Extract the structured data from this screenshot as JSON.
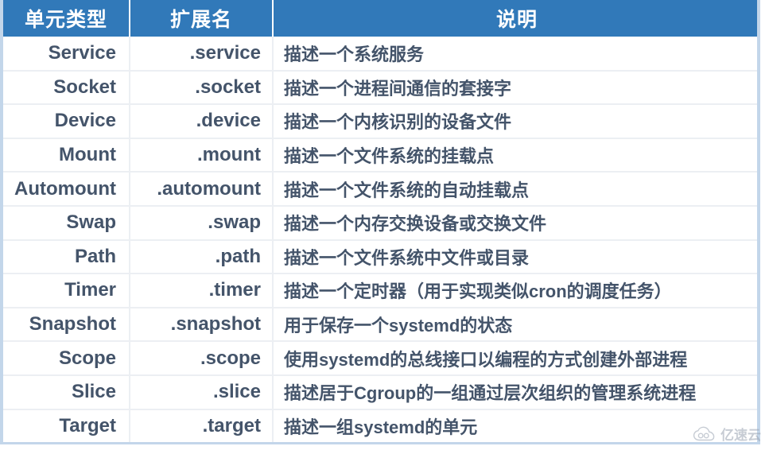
{
  "table": {
    "headers": {
      "unit_type": "单元类型",
      "extension": "扩展名",
      "description": "说明"
    },
    "header_bg": "#3179b9",
    "header_text_color": "#ffffff",
    "body_text_color": "#44546a",
    "border_color": "#c3d6ea",
    "row_separator_color": "#eceff3",
    "rows": [
      {
        "type": "Service",
        "ext": ".service",
        "desc": "描述一个系统服务"
      },
      {
        "type": "Socket",
        "ext": ".socket",
        "desc": "描述一个进程间通信的套接字"
      },
      {
        "type": "Device",
        "ext": ".device",
        "desc": "描述一个内核识别的设备文件"
      },
      {
        "type": "Mount",
        "ext": ".mount",
        "desc": "描述一个文件系统的挂载点"
      },
      {
        "type": "Automount",
        "ext": ".automount",
        "desc": "描述一个文件系统的自动挂载点"
      },
      {
        "type": "Swap",
        "ext": ".swap",
        "desc": "描述一个内存交换设备或交换文件"
      },
      {
        "type": "Path",
        "ext": ".path",
        "desc": "描述一个文件系统中文件或目录"
      },
      {
        "type": "Timer",
        "ext": ".timer",
        "desc": "描述一个定时器（用于实现类似cron的调度任务）"
      },
      {
        "type": "Snapshot",
        "ext": ".snapshot",
        "desc": "用于保存一个systemd的状态"
      },
      {
        "type": "Scope",
        "ext": ".scope",
        "desc": "使用systemd的总线接口以编程的方式创建外部进程"
      },
      {
        "type": "Slice",
        "ext": ".slice",
        "desc": "描述居于Cgroup的一组通过层次组织的管理系统进程"
      },
      {
        "type": "Target",
        "ext": ".target",
        "desc": "描述一组systemd的单元"
      }
    ]
  },
  "watermark": {
    "text": "亿速云",
    "icon": "cloud-icon",
    "color": "#9aa4b2"
  }
}
